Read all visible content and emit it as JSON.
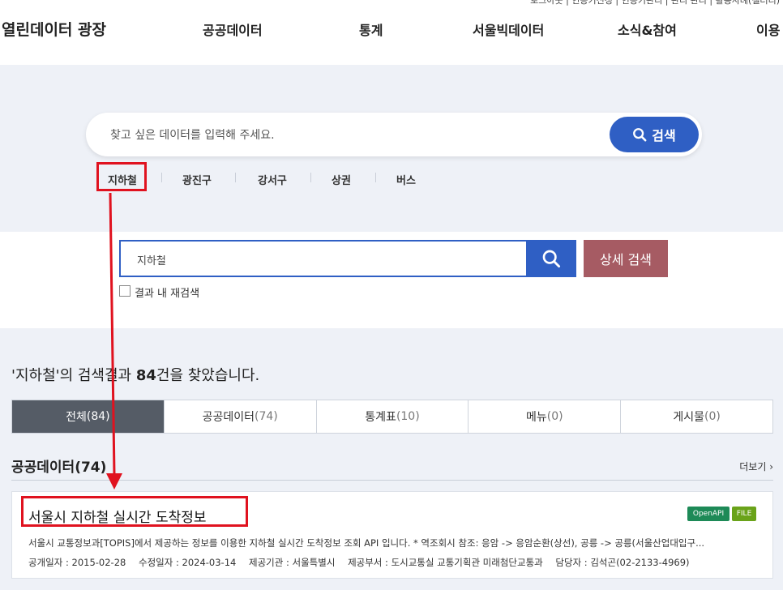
{
  "header": {
    "util_links": "로그아웃 | 인증키신청 | 인증키관리 | 관리 관리 | 활용사례(갤러리)",
    "logo": "열린데이터 광장",
    "nav": [
      "공공데이터",
      "통계",
      "서울빅데이터",
      "소식&참여",
      "이용"
    ]
  },
  "hero": {
    "placeholder": "찾고 싶은 데이터를 입력해 주세요.",
    "search_button": "검색",
    "keywords": [
      "지하철",
      "광진구",
      "강서구",
      "상권",
      "버스"
    ]
  },
  "search2": {
    "value": "지하철",
    "detail_button": "상세 검색",
    "research_label": "결과 내 재검색"
  },
  "results": {
    "summary_prefix": "'지하철'의 검색결과 ",
    "summary_count": "84",
    "summary_suffix": "건을 찾았습니다.",
    "tabs": [
      {
        "label": "전체",
        "count": "(84)"
      },
      {
        "label": "공공데이터",
        "count": "(74)"
      },
      {
        "label": "통계표",
        "count": "(10)"
      },
      {
        "label": "메뉴",
        "count": "(0)"
      },
      {
        "label": "게시물",
        "count": "(0)"
      }
    ],
    "section_title": "공공데이터(74)",
    "more": "더보기 ›",
    "card": {
      "title": "서울시 지하철 실시간 도착정보",
      "badges": [
        "OpenAPI",
        "FILE"
      ],
      "description": "서울시 교통정보과[TOPIS]에서 제공하는 정보를 이용한 지하철 실시간 도착정보 조회 API 입니다. * 역조회시 참조: 응암 -> 응암순환(상선), 공릉 -> 공릉(서울산업대입구...",
      "meta": [
        "공개일자 : 2015-02-28",
        "수정일자 : 2024-03-14",
        "제공기관 : 서울특별시",
        "제공부서 : 도시교통실 교통기획관 미래첨단교통과",
        "담당자 : 김석곤(02-2133-4969)"
      ]
    }
  },
  "colors": {
    "accent": "#2f5fc4",
    "highlight": "#e0121f",
    "detail_button": "#a65b63",
    "tab_active": "#555c66"
  }
}
